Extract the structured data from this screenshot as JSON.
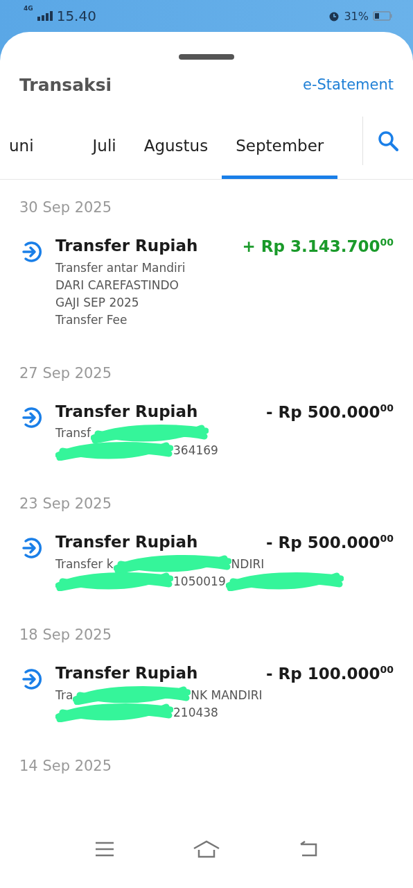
{
  "status_bar": {
    "network": "4G",
    "time": "15.40",
    "battery": "31%"
  },
  "header": {
    "title": "Transaksi",
    "link": "e-Statement"
  },
  "tabs": [
    {
      "label": "uni",
      "selected": false
    },
    {
      "label": "Juli",
      "selected": false
    },
    {
      "label": "Agustus",
      "selected": false
    },
    {
      "label": "September",
      "selected": true
    }
  ],
  "groups": [
    {
      "date": "30 Sep 2025",
      "transactions": [
        {
          "title": "Transfer Rupiah",
          "kind": "credit",
          "amount": "+ Rp 3.143.700",
          "cents": "00",
          "details": [
            [
              {
                "kind": "text",
                "text": "Transfer antar Mandiri"
              }
            ],
            [
              {
                "kind": "text",
                "text": "DARI CAREFASTINDO"
              }
            ],
            [
              {
                "kind": "text",
                "text": "GAJI SEP 2025"
              }
            ],
            [
              {
                "kind": "text",
                "text": "Transfer Fee"
              }
            ]
          ]
        }
      ]
    },
    {
      "date": "27 Sep 2025",
      "transactions": [
        {
          "title": "Transfer Rupiah",
          "kind": "debit",
          "amount": "- Rp 500.000",
          "cents": "00",
          "details": [
            [
              {
                "kind": "text",
                "text": "Transf"
              },
              {
                "kind": "redacted"
              }
            ],
            [
              {
                "kind": "redacted"
              },
              {
                "kind": "text",
                "text": "364169"
              }
            ]
          ]
        }
      ]
    },
    {
      "date": "23 Sep 2025",
      "transactions": [
        {
          "title": "Transfer Rupiah",
          "kind": "debit",
          "amount": "- Rp 500.000",
          "cents": "00",
          "details": [
            [
              {
                "kind": "text",
                "text": "Transfer k"
              },
              {
                "kind": "redacted"
              },
              {
                "kind": "text",
                "text": "NDIRI"
              }
            ],
            [
              {
                "kind": "redacted"
              },
              {
                "kind": "text",
                "text": "1050019"
              },
              {
                "kind": "redacted"
              }
            ]
          ]
        }
      ]
    },
    {
      "date": "18 Sep 2025",
      "transactions": [
        {
          "title": "Transfer Rupiah",
          "kind": "debit",
          "amount": "- Rp 100.000",
          "cents": "00",
          "details": [
            [
              {
                "kind": "text",
                "text": "Tra"
              },
              {
                "kind": "redacted"
              },
              {
                "kind": "text",
                "text": "NK MANDIRI"
              }
            ],
            [
              {
                "kind": "redacted"
              },
              {
                "kind": "text",
                "text": "210438"
              }
            ]
          ]
        }
      ]
    },
    {
      "date": "14 Sep 2025"
    }
  ]
}
